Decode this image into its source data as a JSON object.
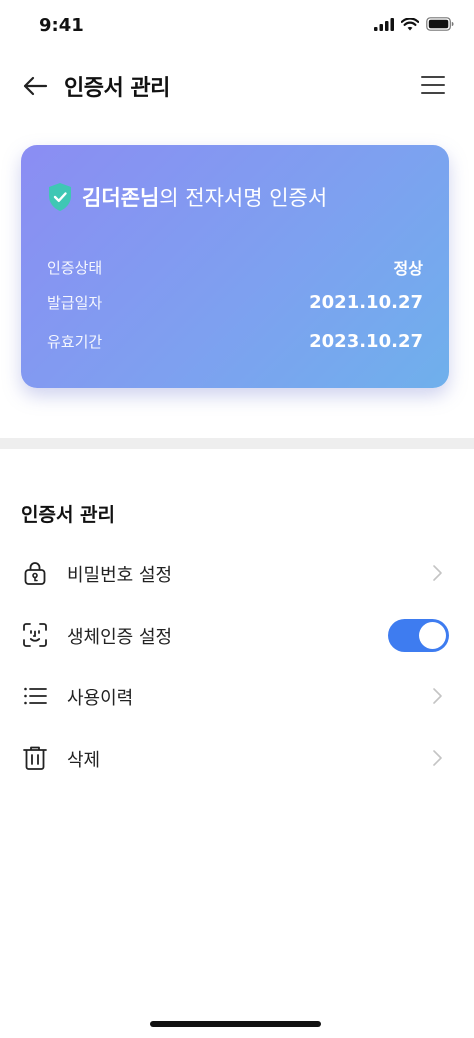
{
  "status_bar": {
    "time": "9:41"
  },
  "nav": {
    "title": "인증서 관리"
  },
  "card": {
    "name": "김더존님",
    "suffix": "의 전자서명 인증서",
    "rows": [
      {
        "label": "인증상태",
        "value": "정상"
      },
      {
        "label": "발급일자",
        "value": "2021.10.27"
      },
      {
        "label": "유효기간",
        "value": "2023.10.27"
      }
    ]
  },
  "section": {
    "title": "인증서 관리"
  },
  "menu": [
    {
      "label": "비밀번호 설정",
      "icon": "lock-icon"
    },
    {
      "label": "생체인증 설정",
      "icon": "face-id-icon",
      "toggle_on": true
    },
    {
      "label": "사용이력",
      "icon": "list-icon"
    },
    {
      "label": "삭제",
      "icon": "trash-icon"
    }
  ],
  "colors": {
    "accent": "#3e7cf0",
    "card_start": "#8b8df3",
    "card_end": "#6fb0ec"
  }
}
